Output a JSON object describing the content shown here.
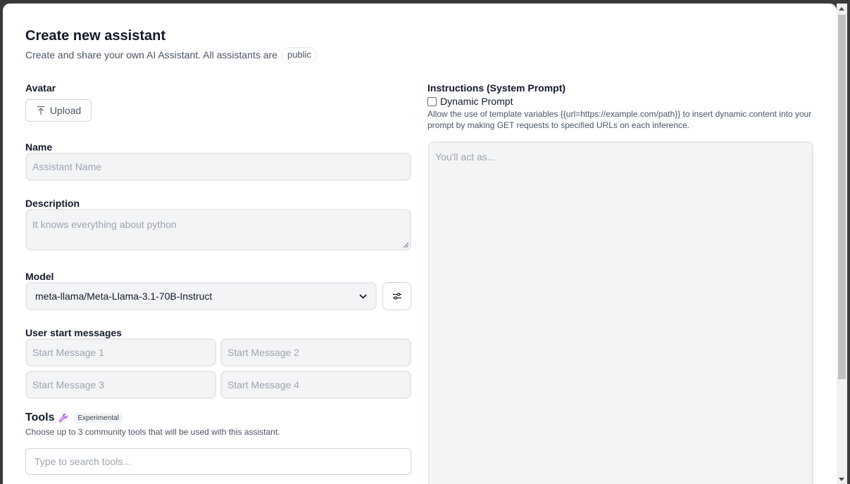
{
  "header": {
    "title": "Create new assistant",
    "subtitle": "Create and share your own AI Assistant. All assistants are",
    "visibility_badge": "public"
  },
  "avatar": {
    "label": "Avatar",
    "upload_label": "Upload"
  },
  "name": {
    "label": "Name",
    "placeholder": "Assistant Name"
  },
  "description": {
    "label": "Description",
    "placeholder": "It knows everything about python"
  },
  "model": {
    "label": "Model",
    "selected": "meta-llama/Meta-Llama-3.1-70B-Instruct"
  },
  "start_messages": {
    "label": "User start messages",
    "placeholders": [
      "Start Message 1",
      "Start Message 2",
      "Start Message 3",
      "Start Message 4"
    ]
  },
  "tools": {
    "title": "Tools",
    "badge": "Experimental",
    "description": "Choose up to 3 community tools that will be used with this assistant.",
    "search_placeholder": "Type to search tools..."
  },
  "instructions": {
    "label": "Instructions (System Prompt)",
    "dynamic_label": "Dynamic Prompt",
    "dynamic_checked": false,
    "dynamic_help": "Allow the use of template variables {{url=https://example.com/path}} to insert dynamic content into your prompt by making GET requests to specified URLs on each inference.",
    "placeholder": "You'll act as..."
  },
  "colors": {
    "accent": "#a855f7",
    "field_bg": "#f3f4f6",
    "border": "#e5e7eb"
  }
}
